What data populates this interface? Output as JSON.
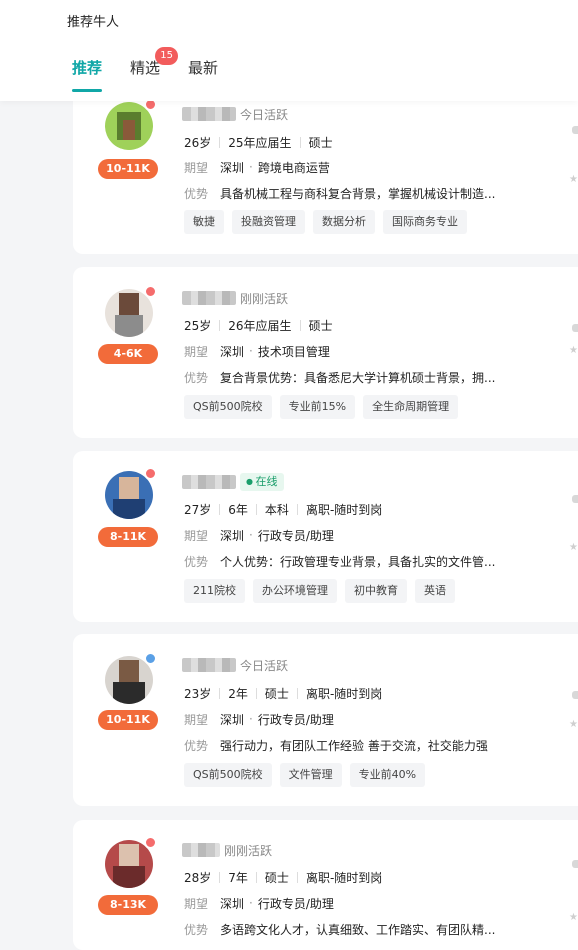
{
  "header": {
    "title": "推荐牛人",
    "tabs": [
      {
        "label": "推荐",
        "active": true
      },
      {
        "label": "精选",
        "badge": "15"
      },
      {
        "label": "最新"
      }
    ]
  },
  "colors": {
    "accent": "#10a7a7",
    "salary": "#f26b3a",
    "badge": "#f25c5c",
    "online": "#1a9e6b"
  },
  "candidates": [
    {
      "salary": "10-11K",
      "activity": "今日活跃",
      "meta": [
        "26岁",
        "25年应届生",
        "硕士"
      ],
      "expect_label": "期望",
      "expect_city": "深圳",
      "expect_job": "跨境电商运营",
      "adv_label": "优势",
      "advantage": "具备机械工程与商科复合背景，掌握机械设计制造...",
      "tags": [
        "敏捷",
        "投融资管理",
        "数据分析",
        "国际商务专业"
      ]
    },
    {
      "salary": "4-6K",
      "activity": "刚刚活跃",
      "meta": [
        "25岁",
        "26年应届生",
        "硕士"
      ],
      "expect_label": "期望",
      "expect_city": "深圳",
      "expect_job": "技术项目管理",
      "adv_label": "优势",
      "advantage": "复合背景优势：具备悉尼大学计算机硕士背景，拥...",
      "tags": [
        "QS前500院校",
        "专业前15%",
        "全生命周期管理"
      ]
    },
    {
      "salary": "8-11K",
      "activity": "在线",
      "meta": [
        "27岁",
        "6年",
        "本科",
        "离职-随时到岗"
      ],
      "expect_label": "期望",
      "expect_city": "深圳",
      "expect_job": "行政专员/助理",
      "adv_label": "优势",
      "advantage": "个人优势：行政管理专业背景，具备扎实的文件管...",
      "tags": [
        "211院校",
        "办公环境管理",
        "初中教育",
        "英语"
      ]
    },
    {
      "salary": "10-11K",
      "activity": "今日活跃",
      "meta": [
        "23岁",
        "2年",
        "硕士",
        "离职-随时到岗"
      ],
      "expect_label": "期望",
      "expect_city": "深圳",
      "expect_job": "行政专员/助理",
      "adv_label": "优势",
      "advantage": "强行动力，有团队工作经验 善于交流，社交能力强",
      "tags": [
        "QS前500院校",
        "文件管理",
        "专业前40%"
      ]
    },
    {
      "salary": "8-13K",
      "activity": "刚刚活跃",
      "meta": [
        "28岁",
        "7年",
        "硕士",
        "离职-随时到岗"
      ],
      "expect_label": "期望",
      "expect_city": "深圳",
      "expect_job": "行政专员/助理",
      "adv_label": "优势",
      "advantage": "多语跨文化人才，认真细致、工作踏实、有团队精..."
    }
  ]
}
